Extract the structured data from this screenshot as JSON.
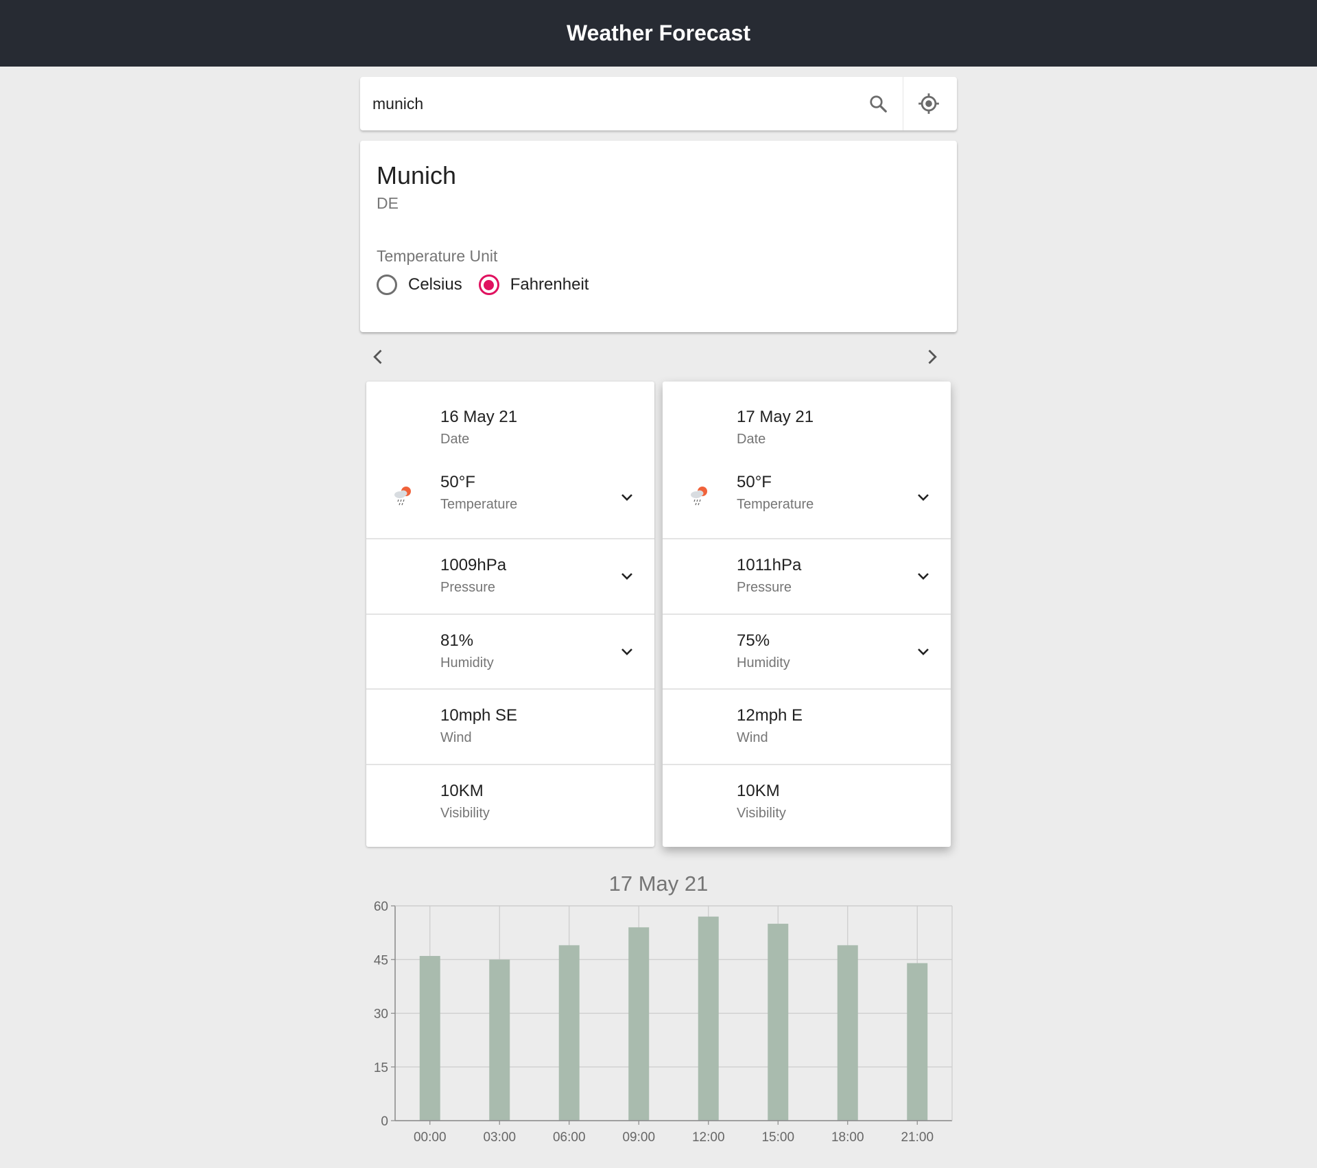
{
  "app": {
    "title": "Weather Forecast"
  },
  "search": {
    "value": "munich"
  },
  "location": {
    "city": "Munich",
    "country": "DE",
    "unit_label": "Temperature Unit",
    "units": [
      {
        "label": "Celsius",
        "selected": false
      },
      {
        "label": "Fahrenheit",
        "selected": true
      }
    ]
  },
  "colors": {
    "accent": "#e0115f",
    "header": "#272b33",
    "bar": "#a9bbae"
  },
  "days": [
    {
      "date": "16 May 21",
      "date_label": "Date",
      "temperature": "50°F",
      "temperature_label": "Temperature",
      "weather_icon": "rain-sun-icon",
      "pressure": "1009hPa",
      "pressure_label": "Pressure",
      "humidity": "81%",
      "humidity_label": "Humidity",
      "wind": "10mph SE",
      "wind_label": "Wind",
      "visibility": "10KM",
      "visibility_label": "Visibility"
    },
    {
      "date": "17 May 21",
      "date_label": "Date",
      "temperature": "50°F",
      "temperature_label": "Temperature",
      "weather_icon": "rain-sun-icon",
      "pressure": "1011hPa",
      "pressure_label": "Pressure",
      "humidity": "75%",
      "humidity_label": "Humidity",
      "wind": "12mph E",
      "wind_label": "Wind",
      "visibility": "10KM",
      "visibility_label": "Visibility"
    }
  ],
  "chart_data": {
    "type": "bar",
    "title": "17 May 21",
    "categories": [
      "00:00",
      "03:00",
      "06:00",
      "09:00",
      "12:00",
      "15:00",
      "18:00",
      "21:00"
    ],
    "values": [
      46,
      45,
      49,
      54,
      57,
      55,
      49,
      44
    ],
    "yticks": [
      "0",
      "15",
      "30",
      "45",
      "60"
    ],
    "ylim": [
      0,
      60
    ],
    "grid": true
  }
}
